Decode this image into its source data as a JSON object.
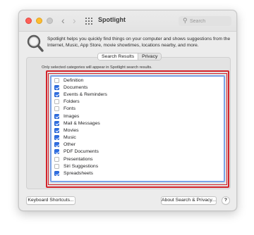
{
  "window": {
    "title": "Spotlight",
    "search_placeholder": "Search"
  },
  "header": {
    "description": "Spotlight helps you quickly find things on your computer and shows suggestions from the Internet, Music, App Store, movie showtimes, locations nearby, and more."
  },
  "tabs": [
    {
      "label": "Search Results",
      "active": true
    },
    {
      "label": "Privacy",
      "active": false
    }
  ],
  "note": "Only selected categories will appear in Spotlight search results.",
  "categories": [
    {
      "label": "Definition",
      "checked": false
    },
    {
      "label": "Documents",
      "checked": true
    },
    {
      "label": "Events & Reminders",
      "checked": true
    },
    {
      "label": "Folders",
      "checked": false
    },
    {
      "label": "Fonts",
      "checked": false
    },
    {
      "label": "Images",
      "checked": true
    },
    {
      "label": "Mail & Messages",
      "checked": true
    },
    {
      "label": "Movies",
      "checked": true
    },
    {
      "label": "Music",
      "checked": true
    },
    {
      "label": "Other",
      "checked": true
    },
    {
      "label": "PDF Documents",
      "checked": true
    },
    {
      "label": "Presentations",
      "checked": false
    },
    {
      "label": "Siri Suggestions",
      "checked": false
    },
    {
      "label": "Spreadsheets",
      "checked": true
    }
  ],
  "buttons": {
    "keyboard_shortcuts": "Keyboard Shortcuts...",
    "about": "About Search & Privacy...",
    "help": "?"
  },
  "colors": {
    "accent": "#2f6fe4",
    "highlight": "#d3232a",
    "close": "#fe5f57",
    "minimize": "#febc2e"
  }
}
